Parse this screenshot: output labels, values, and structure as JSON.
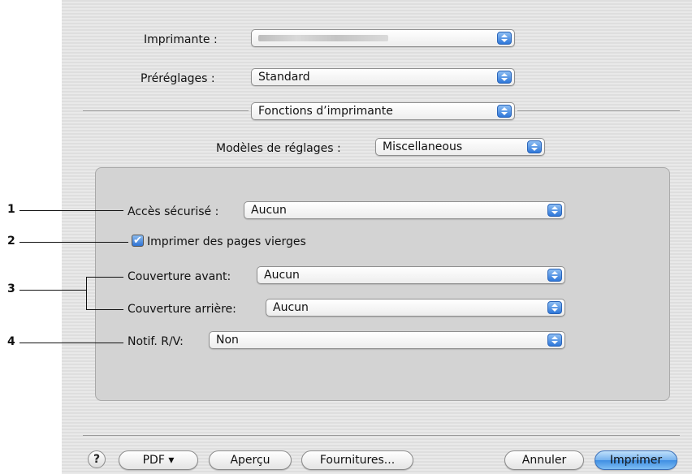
{
  "printer": {
    "label": "Imprimante :",
    "value": ""
  },
  "presets": {
    "label": "Préréglages :",
    "value": "Standard"
  },
  "panel_selector": {
    "value": "Fonctions d’imprimante"
  },
  "feature_sets": {
    "label": "Modèles de réglages :",
    "value": "Miscellaneous"
  },
  "settings": {
    "secure_access": {
      "label": "Accès sécurisé :",
      "value": "Aucun"
    },
    "print_blank_pages": {
      "label": "Imprimer des pages vierges",
      "checked": true,
      "check_glyph": "✔"
    },
    "front_cover": {
      "label": "Couverture avant:",
      "value": "Aucun"
    },
    "back_cover": {
      "label": "Couverture arrière:",
      "value": "Aucun"
    },
    "notif_rv": {
      "label": "Notif. R/V:",
      "value": "Non"
    }
  },
  "annotations": [
    "1",
    "2",
    "3",
    "4"
  ],
  "buttons": {
    "help": "?",
    "pdf": "PDF ▾",
    "preview": "Aperçu",
    "supplies": "Fournitures...",
    "cancel": "Annuler",
    "print": "Imprimer"
  },
  "colors": {
    "accent": "#3f8fe3"
  }
}
